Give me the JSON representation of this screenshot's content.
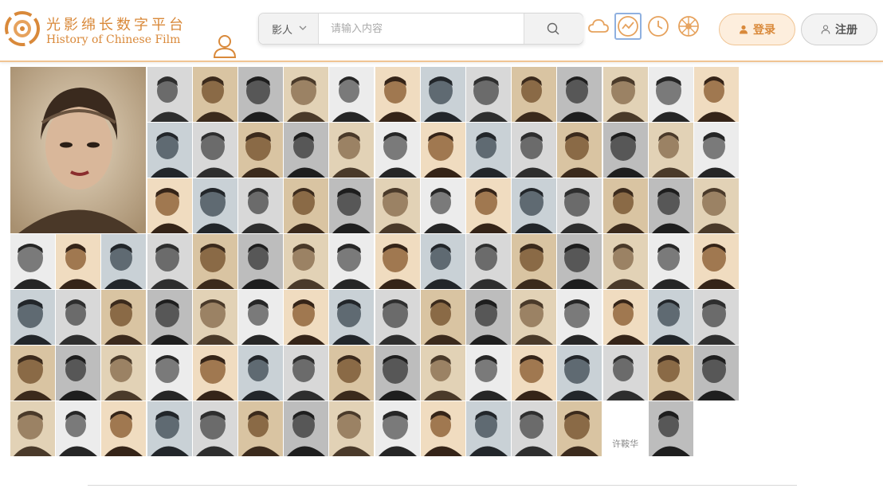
{
  "header": {
    "logo_icon": "film-reel-logo-icon",
    "title_cn": "光影绵长数字平台",
    "title_en": "History of Chinese Film",
    "accent_color": "#d9893a"
  },
  "user_menu": {
    "icon": "user-icon"
  },
  "search": {
    "type_label": "影人",
    "placeholder": "请输入内容",
    "value": "",
    "button_icon": "search-icon"
  },
  "toolbar": {
    "tools": [
      {
        "name": "cloud-icon",
        "active": false
      },
      {
        "name": "trend-chart-icon",
        "active": true
      },
      {
        "name": "clock-icon",
        "active": false
      },
      {
        "name": "film-wheel-icon",
        "active": false
      }
    ]
  },
  "auth": {
    "login_label": "登录",
    "register_label": "注册"
  },
  "gallery": {
    "featured_person": "portrait-tile",
    "name_tile_label": "许鞍华",
    "rows": 7,
    "columns": 16
  }
}
